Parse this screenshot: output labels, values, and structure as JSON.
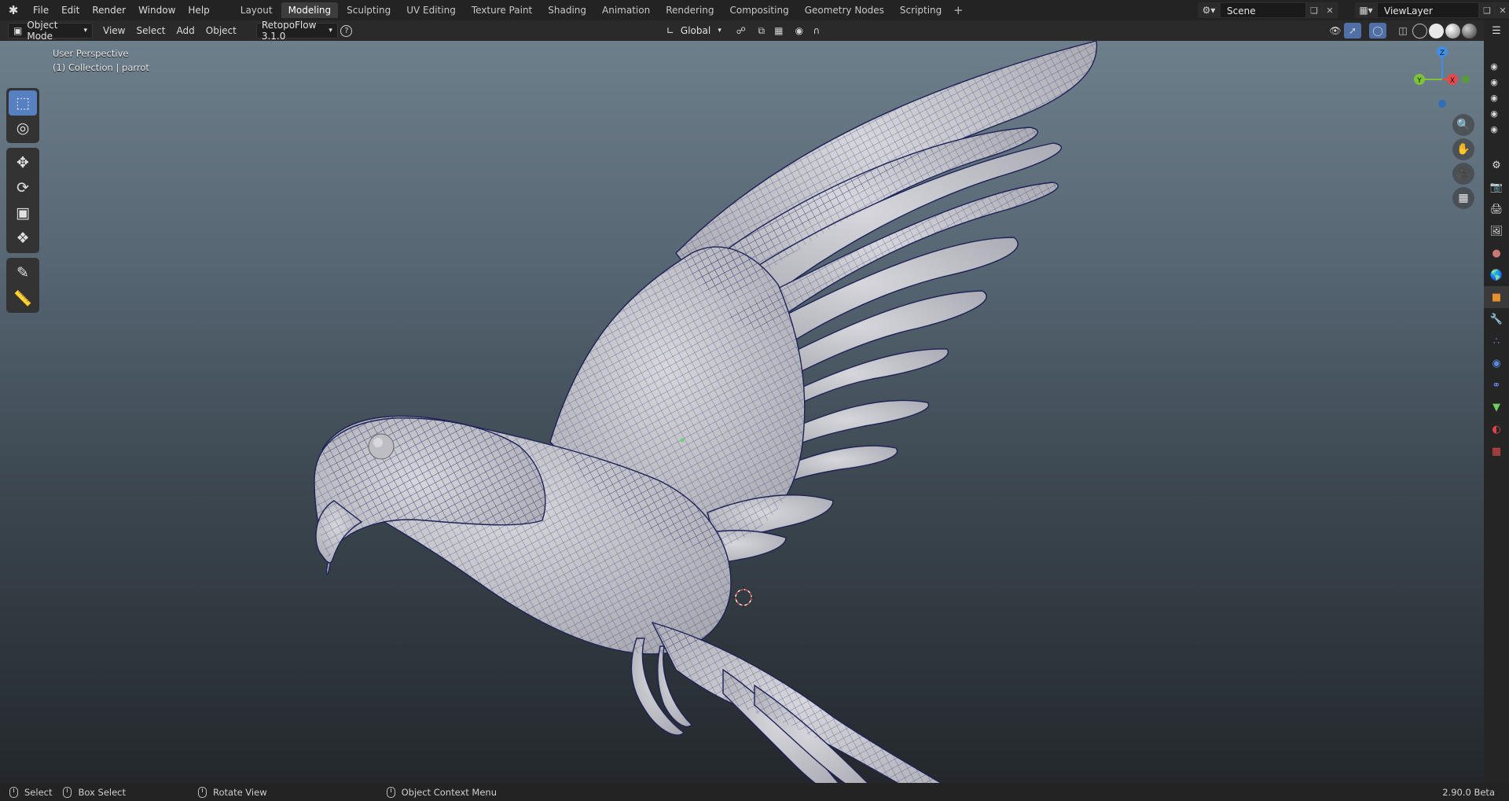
{
  "menubar": {
    "logo_icon": "blender-logo-icon",
    "menus": [
      "File",
      "Edit",
      "Render",
      "Window",
      "Help"
    ],
    "tabs": [
      "Layout",
      "Modeling",
      "Sculpting",
      "UV Editing",
      "Texture Paint",
      "Shading",
      "Animation",
      "Rendering",
      "Compositing",
      "Geometry Nodes",
      "Scripting"
    ],
    "active_tab": "Modeling",
    "add_tab": "+",
    "scene_name": "Scene",
    "view_layer": "ViewLayer"
  },
  "header": {
    "mode": "Object Mode",
    "menus": [
      "View",
      "Select",
      "Add",
      "Object"
    ],
    "addon": "RetopoFlow 3.1.0",
    "help_icon": "?",
    "transform_orientation": "Global"
  },
  "viewport": {
    "perspective_label": "User Perspective",
    "collection_label": "(1) Collection | parrot",
    "background_top": "#6e7f8c",
    "background_bottom": "#23282c",
    "mesh_color": "#c9c9cf",
    "wire_color": "#2a2d6a",
    "gizmo": {
      "x": "X",
      "y": "Y",
      "z": "Z",
      "x_color": "#e54a4a",
      "y_color": "#7bc43a",
      "z_color": "#3f8fe8"
    }
  },
  "toolbar": {
    "tools": [
      "select-box",
      "cursor",
      "move",
      "rotate",
      "scale",
      "transform",
      "annotate",
      "measure"
    ],
    "active_tool": "select-box"
  },
  "status": {
    "items": [
      "Select",
      "Box Select",
      "Rotate View",
      "Object Context Menu"
    ],
    "version": "2.90.0 Beta"
  }
}
